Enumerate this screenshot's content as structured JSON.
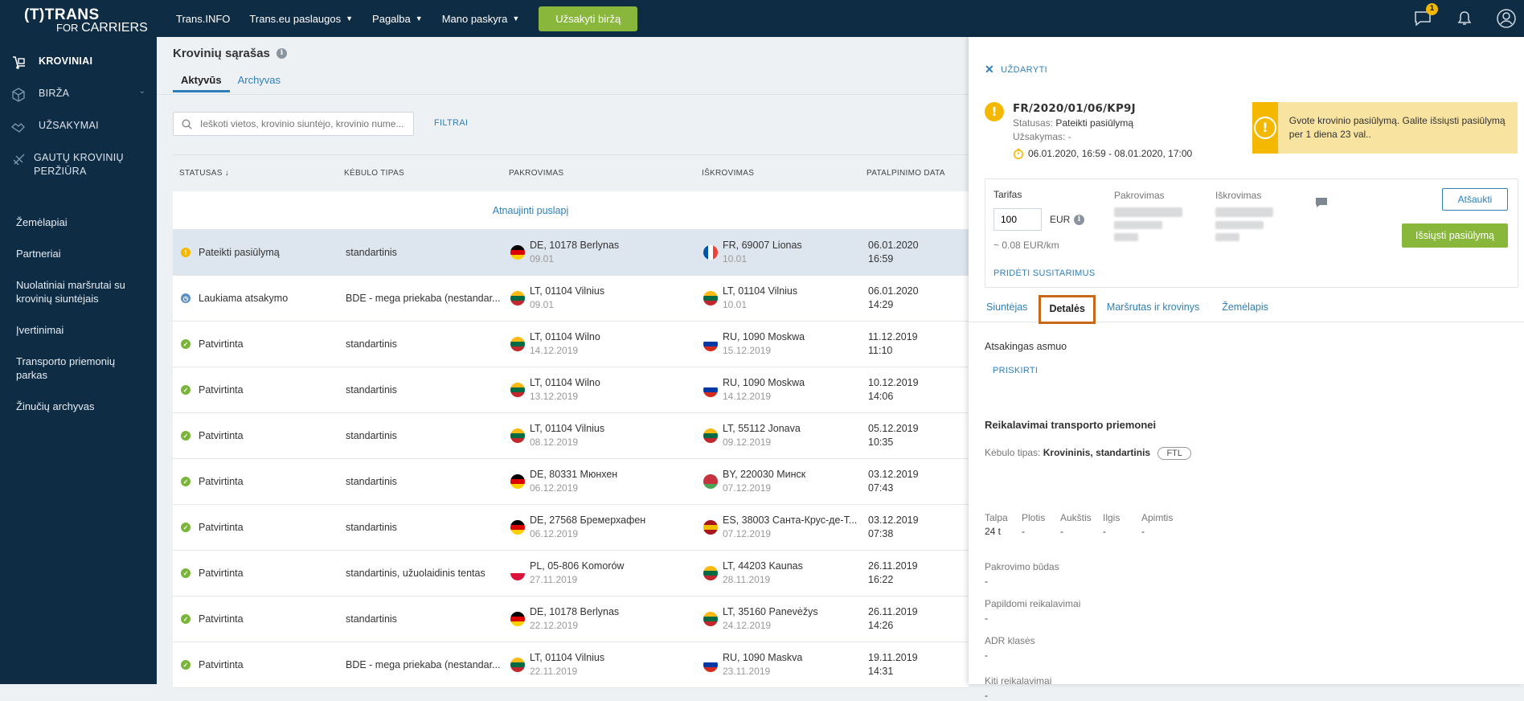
{
  "brand": {
    "line1": "(T)TRANS",
    "line2_prefix": "FOR ",
    "line2": "CARRIERS"
  },
  "sidebar": {
    "items": [
      {
        "label": "KROVINIAI"
      },
      {
        "label": "BIRŽA"
      },
      {
        "label": "UŽSAKYMAI"
      },
      {
        "label": "GAUTŲ KROVINIŲ PERŽIŪRA"
      }
    ],
    "sub": [
      "Žemėlapiai",
      "Partneriai",
      "Nuolatiniai maršrutai su krovinių siuntėjais",
      "Įvertinimai",
      "Transporto priemonių parkas",
      "Žinučių archyvas"
    ]
  },
  "topbar": {
    "items": [
      "Trans.INFO",
      "Trans.eu paslaugos",
      "Pagalba",
      "Mano paskyra"
    ],
    "cta": "Užsakyti biržą",
    "chat_badge": "1"
  },
  "main": {
    "title": "Krovinių sąrašas",
    "tabs": [
      "Aktyvūs",
      "Archyvas"
    ],
    "search_placeholder": "Ieškoti vietos, krovinio siuntėjo, krovinio nume...",
    "filters": "FILTRAI",
    "columns": [
      "STATUSAS ↓",
      "KĖBULO TIPAS",
      "PAKROVIMAS",
      "IŠKROVIMAS",
      "PATALPINIMO DATA"
    ],
    "reload": "Atnaujinti puslapį",
    "rows": [
      {
        "status": "Pateikti pasiūlymą",
        "stype": "warn",
        "body": "standartinis",
        "load": "DE, 10178 Berlynas",
        "load_date": "09.01",
        "lflag": "de",
        "unload": "FR, 69007 Lionas",
        "unload_date": "10.01",
        "uflag": "fr",
        "date": "06.01.2020",
        "time": "16:59"
      },
      {
        "status": "Laukiama atsakymo",
        "stype": "wait",
        "body": "BDE - mega priekaba (nestandar...",
        "load": "LT, 01104 Vilnius",
        "load_date": "09.01",
        "lflag": "lt",
        "unload": "LT, 01104 Vilnius",
        "unload_date": "10.01",
        "uflag": "lt",
        "date": "06.01.2020",
        "time": "14:29"
      },
      {
        "status": "Patvirtinta",
        "stype": "ok",
        "body": "standartinis",
        "load": "LT, 01104 Wilno",
        "load_date": "14.12.2019",
        "lflag": "lt",
        "unload": "RU, 1090 Moskwa",
        "unload_date": "15.12.2019",
        "uflag": "ru",
        "date": "11.12.2019",
        "time": "11:10"
      },
      {
        "status": "Patvirtinta",
        "stype": "ok",
        "body": "standartinis",
        "load": "LT, 01104 Wilno",
        "load_date": "13.12.2019",
        "lflag": "lt",
        "unload": "RU, 1090 Moskwa",
        "unload_date": "14.12.2019",
        "uflag": "ru",
        "date": "10.12.2019",
        "time": "14:06"
      },
      {
        "status": "Patvirtinta",
        "stype": "ok",
        "body": "standartinis",
        "load": "LT, 01104 Vilnius",
        "load_date": "08.12.2019",
        "lflag": "lt",
        "unload": "LT, 55112 Jonava",
        "unload_date": "09.12.2019",
        "uflag": "lt",
        "date": "05.12.2019",
        "time": "10:35"
      },
      {
        "status": "Patvirtinta",
        "stype": "ok",
        "body": "standartinis",
        "load": "DE, 80331 Мюнхен",
        "load_date": "06.12.2019",
        "lflag": "de",
        "unload": "BY, 220030 Минск",
        "unload_date": "07.12.2019",
        "uflag": "by",
        "date": "03.12.2019",
        "time": "07:43"
      },
      {
        "status": "Patvirtinta",
        "stype": "ok",
        "body": "standartinis",
        "load": "DE, 27568 Бремерхафен",
        "load_date": "06.12.2019",
        "lflag": "de",
        "unload": "ES, 38003 Санта-Крус-де-Т...",
        "unload_date": "07.12.2019",
        "uflag": "es",
        "date": "03.12.2019",
        "time": "07:38"
      },
      {
        "status": "Patvirtinta",
        "stype": "ok",
        "body": "standartinis, užuolaidinis tentas",
        "load": "PL, 05-806 Komorów",
        "load_date": "27.11.2019",
        "lflag": "pl",
        "unload": "LT, 44203 Kaunas",
        "unload_date": "28.11.2019",
        "uflag": "lt",
        "date": "26.11.2019",
        "time": "16:22"
      },
      {
        "status": "Patvirtinta",
        "stype": "ok",
        "body": "standartinis",
        "load": "DE, 10178 Berlynas",
        "load_date": "22.12.2019",
        "lflag": "de",
        "unload": "LT, 35160 Panevėžys",
        "unload_date": "24.12.2019",
        "uflag": "lt",
        "date": "26.11.2019",
        "time": "14:26"
      },
      {
        "status": "Patvirtinta",
        "stype": "ok",
        "body": "BDE - mega priekaba (nestandar...",
        "load": "LT, 01104 Vilnius",
        "load_date": "22.11.2019",
        "lflag": "lt",
        "unload": "RU, 1090 Maskva",
        "unload_date": "23.11.2019",
        "uflag": "ru",
        "date": "19.11.2019",
        "time": "14:31"
      }
    ]
  },
  "panel": {
    "close": "UŽDARYTI",
    "ref": "FR/2020/01/06/KP9J",
    "status_label": "Statusas:",
    "status_value": "Pateikti pasiūlymą",
    "order_label": "Užsakymas:",
    "order_value": "-",
    "time_range": "06.01.2020, 16:59 - 08.01.2020, 17:00",
    "alert": "Gvote krovinio pasiūlymą. Galite išsiųsti pasiūlymą per 1 diena 23 val..",
    "tarif_label": "Tarifas",
    "tarif_value": "100",
    "currency": "EUR",
    "per_km": "~ 0.08 EUR/km",
    "loading_label": "Pakrovimas",
    "unloading_label": "Iškrovimas",
    "cancel_btn": "Atšaukti",
    "send_btn": "Išsiųsti pasiūlymą",
    "add_terms": "PRIDĖTI SUSITARIMUS",
    "tabs": [
      "Siuntėjas",
      "Detalės",
      "Maršrutas ir krovinys",
      "Žemėlapis"
    ],
    "responsible": "Atsakingas asmuo",
    "assign": "PRISKIRTI",
    "req_title": "Reikalavimai transporto priemonei",
    "body_label": "Kėbulo tipas:",
    "body_value": "Krovininis, standartinis",
    "ftl": "FTL",
    "dims": [
      {
        "k": "Talpa",
        "v": "24 t"
      },
      {
        "k": "Plotis",
        "v": "-"
      },
      {
        "k": "Aukštis",
        "v": "-"
      },
      {
        "k": "Ilgis",
        "v": "-"
      },
      {
        "k": "Apimtis",
        "v": "-"
      }
    ],
    "fields": [
      {
        "k": "Pakrovimo būdas",
        "v": "-"
      },
      {
        "k": "Papildomi reikalavimai",
        "v": "-"
      },
      {
        "k": "ADR klasės",
        "v": "-"
      },
      {
        "k": "Kiti reikalavimai",
        "v": "-"
      }
    ]
  }
}
